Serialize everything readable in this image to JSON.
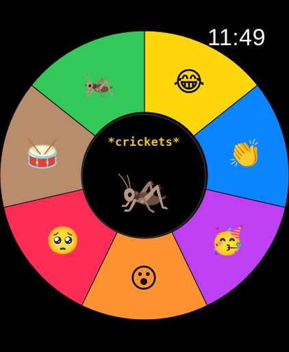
{
  "status": {
    "time": "11:49"
  },
  "center": {
    "label": "*crickets*",
    "emoji": "🦗"
  },
  "wheel": {
    "segments": [
      {
        "name": "laugh",
        "emoji": "😂",
        "color": "#FFD60A"
      },
      {
        "name": "clap",
        "emoji": "👏",
        "color": "#0A84FF"
      },
      {
        "name": "party",
        "emoji": "🥳",
        "color": "#BF40F2"
      },
      {
        "name": "wow",
        "emoji": "😮",
        "color": "#FF9230"
      },
      {
        "name": "pleading",
        "emoji": "🥺",
        "color": "#FF2D55"
      },
      {
        "name": "drum",
        "emoji": "🥁",
        "color": "#B98D6B"
      },
      {
        "name": "cricket",
        "emoji": "🦗",
        "color": "#34C759"
      }
    ]
  }
}
